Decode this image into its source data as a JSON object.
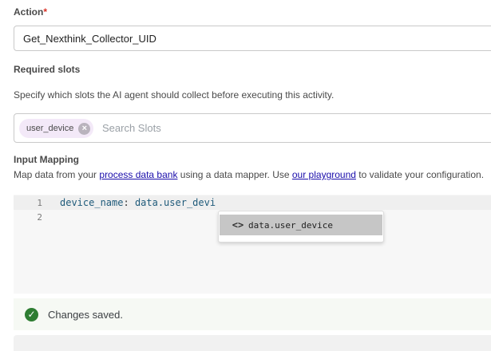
{
  "action": {
    "label": "Action",
    "required_mark": "*",
    "value": "Get_Nexthink_Collector_UID"
  },
  "slots": {
    "label": "Required slots",
    "description": "Specify which slots the AI agent should collect before executing this activity.",
    "chips": [
      {
        "label": "user_device"
      }
    ],
    "search_placeholder": "Search Slots"
  },
  "mapping": {
    "label": "Input Mapping",
    "desc_prefix": "Map data from your ",
    "link1": "process data bank",
    "desc_middle": " using a data mapper. Use ",
    "link2": "our playground",
    "desc_suffix": " to validate your configuration."
  },
  "editor": {
    "lines": [
      {
        "number": "1",
        "key": "device_name",
        "sep": ": ",
        "value": "data.user_devi"
      },
      {
        "number": "2",
        "key": "",
        "sep": "",
        "value": ""
      }
    ],
    "suggestion": {
      "icon": "code-icon",
      "glyph": "<>",
      "label": "data.user_device"
    }
  },
  "toast": {
    "icon": "check-circle-icon",
    "message": "Changes saved."
  },
  "colors": {
    "chip_bg": "#f3e9f8",
    "success": "#2e7d32",
    "link": "#1a0dab"
  }
}
